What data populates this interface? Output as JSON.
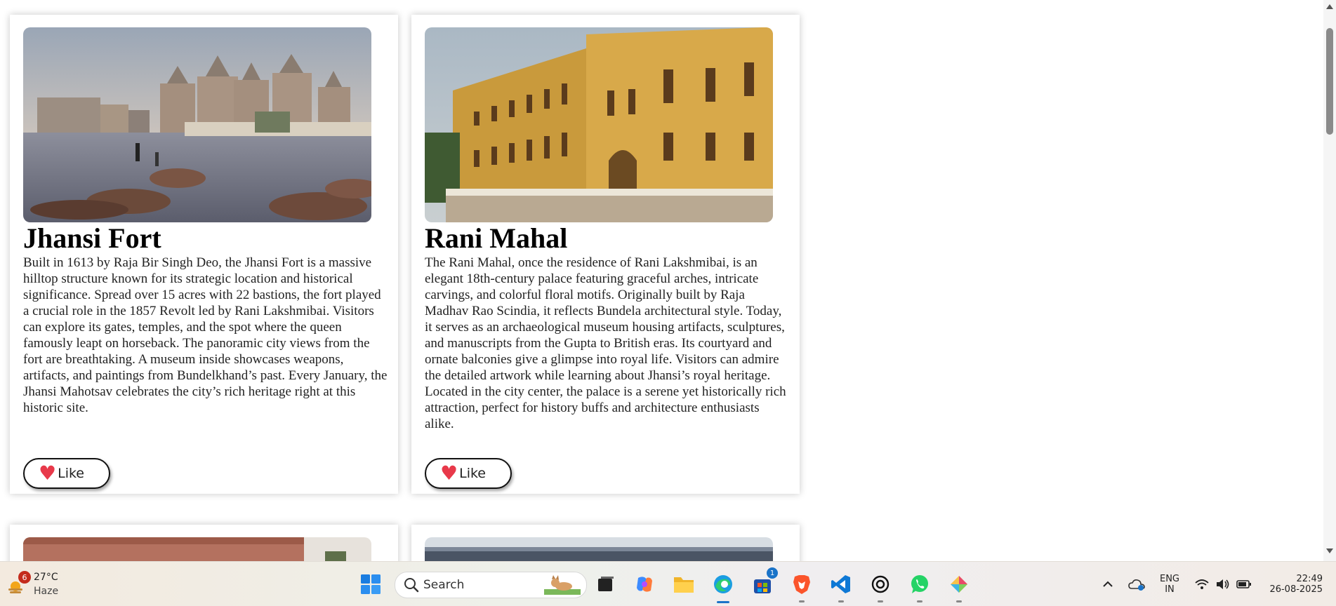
{
  "cards": [
    {
      "title": "Jhansi Fort",
      "description": "Built in 1613 by Raja Bir Singh Deo, the Jhansi Fort is a massive hilltop structure known for its strategic location and historical significance. Spread over 15 acres with 22 bastions, the fort played a crucial role in the 1857 Revolt led by Rani Lakshmibai. Visitors can explore its gates, temples, and the spot where the queen famously leapt on horseback. The panoramic city views from the fort are breathtaking. A museum inside showcases weapons, artifacts, and paintings from Bundelkhand’s past. Every January, the Jhansi Mahotsav celebrates the city’s rich heritage right at this historic site.",
      "like_label": "Like"
    },
    {
      "title": "Rani Mahal",
      "description": "The Rani Mahal, once the residence of Rani Lakshmibai, is an elegant 18th-century palace featuring graceful arches, intricate carvings, and colorful floral motifs. Originally built by Raja Madhav Rao Scindia, it reflects Bundela architectural style. Today, it serves as an archaeological museum housing artifacts, sculptures, and manuscripts from the Gupta to British eras. Its courtyard and ornate balconies give a glimpse into royal life. Visitors can admire the detailed artwork while learning about Jhansi’s royal heritage. Located in the city center, the palace is a serene yet historically rich attraction, perfect for history buffs and architecture enthusiasts alike.",
      "like_label": "Like"
    }
  ],
  "taskbar": {
    "weather": {
      "temp": "27°C",
      "condition": "Haze",
      "badge": "6"
    },
    "search_label": "Search",
    "store_badge": "1",
    "language": {
      "line1": "ENG",
      "line2": "IN"
    },
    "time": "22:49",
    "date": "26-08-2025"
  },
  "colors": {
    "heart": "#e8394a",
    "taskbar_active": "#1a73c8"
  },
  "icons": [
    "start-icon",
    "search-icon",
    "task-view-icon",
    "copilot-icon",
    "file-explorer-icon",
    "edge-icon",
    "store-icon",
    "brave-icon",
    "vscode-icon",
    "chatgpt-icon",
    "whatsapp-icon",
    "paint-icon",
    "chevron-up-icon",
    "onedrive-icon",
    "wifi-icon",
    "volume-icon",
    "battery-icon"
  ]
}
